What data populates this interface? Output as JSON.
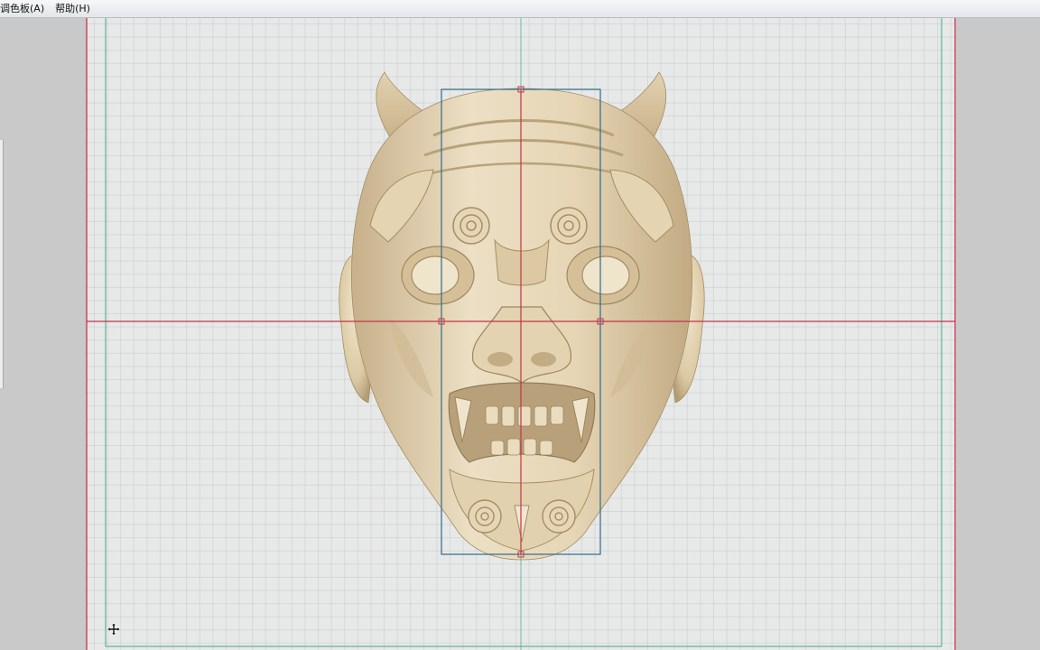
{
  "menu": {
    "palette_label": "调色板(A)",
    "help_label": "帮助(H)"
  },
  "canvas": {
    "model": "oni-demon-mask-relief",
    "colors": {
      "background": "#e7e8e8",
      "guide_red": "#c8324a",
      "guide_green": "#3faa8a",
      "bounding_box": "#2f6c8c",
      "model_light": "#ecdfc4",
      "model_mid": "#d8c49e",
      "model_dark": "#a48e64"
    }
  },
  "icons": {
    "cursor": "move-cursor-icon"
  }
}
